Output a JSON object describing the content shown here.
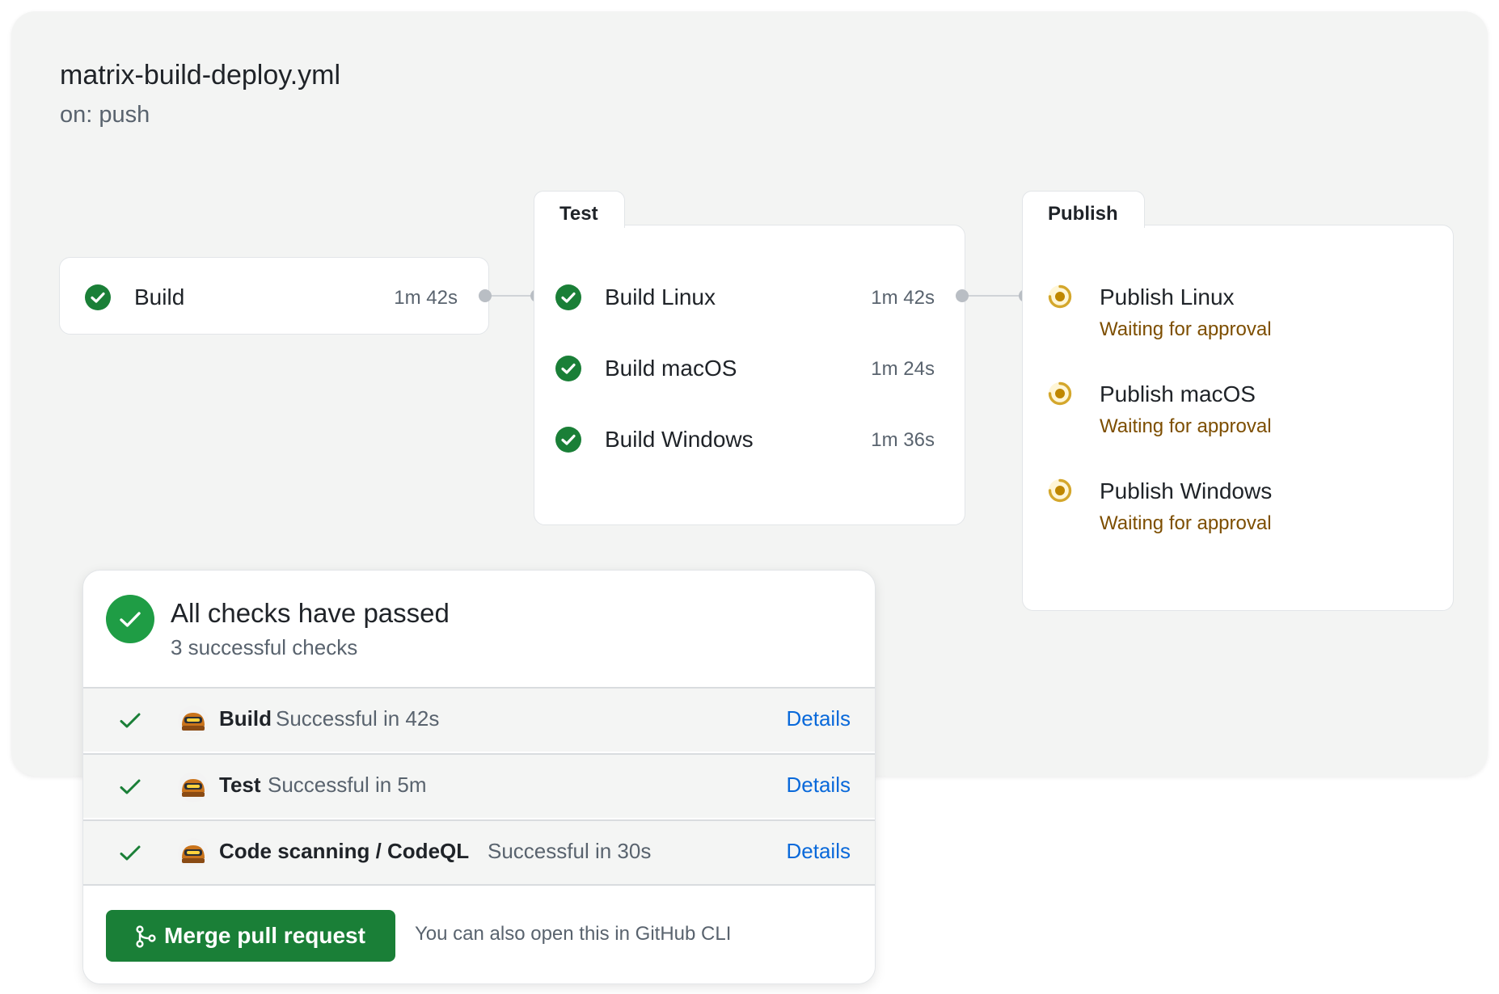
{
  "workflow": {
    "title": "matrix-build-deploy.yml",
    "trigger": "on: push"
  },
  "build_job": {
    "name": "Build",
    "duration": "1m 42s",
    "status": "success"
  },
  "test_group": {
    "label": "Test",
    "jobs": [
      {
        "name": "Build Linux",
        "duration": "1m 42s",
        "status": "success"
      },
      {
        "name": "Build macOS",
        "duration": "1m 24s",
        "status": "success"
      },
      {
        "name": "Build Windows",
        "duration": "1m 36s",
        "status": "success"
      }
    ]
  },
  "publish_group": {
    "label": "Publish",
    "jobs": [
      {
        "name": "Publish Linux",
        "status": "Waiting for approval"
      },
      {
        "name": "Publish macOS",
        "status": "Waiting for approval"
      },
      {
        "name": "Publish Windows",
        "status": "Waiting for approval"
      }
    ]
  },
  "checks": {
    "title": "All checks have passed",
    "subtitle": "3 successful checks",
    "rows": [
      {
        "name": "Build",
        "description": "Successful in 42s",
        "link": "Details",
        "icon": "octocat-avatar"
      },
      {
        "name": "Test",
        "description": "Successful in 5m",
        "link": "Details",
        "icon": "octocat-avatar"
      },
      {
        "name": "Code scanning / CodeQL",
        "description": "Successful in 30s",
        "link": "Details",
        "icon": "octocat-avatar"
      }
    ],
    "merge_button": "Merge pull request",
    "cli_hint": "You can also open this in GitHub CLI"
  },
  "colors": {
    "success": "#1a7f37",
    "waiting": "#bf8700",
    "link": "#0969da",
    "canvas": "#f3f4f3"
  }
}
